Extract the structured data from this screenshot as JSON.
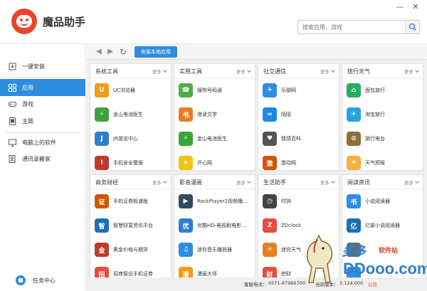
{
  "header": {
    "title": "魔品助手",
    "search_placeholder": "搜索应用，游戏",
    "window_controls": [
      "minimize-icon",
      "close-icon"
    ]
  },
  "sidebar": {
    "items": [
      {
        "label": "一键安装",
        "icon": "install-icon"
      },
      {
        "label": "应用",
        "icon": "apps-grid-icon",
        "active": true
      },
      {
        "label": "游戏",
        "icon": "game-icon"
      },
      {
        "label": "主题",
        "icon": "theme-icon"
      },
      {
        "label": "电脑上的软件",
        "icon": "computer-icon"
      },
      {
        "label": "通讯录搬家",
        "icon": "contacts-icon"
      }
    ],
    "task_center": "任务中心"
  },
  "toolbar": {
    "back": "◀",
    "forward": "▶",
    "refresh": "↻",
    "install_local": "安装本地应用"
  },
  "more_label": "更多",
  "categories": [
    {
      "title": "系统工具",
      "apps": [
        {
          "name": "UC浏览器",
          "color": "#f39c12",
          "glyph": "U"
        },
        {
          "name": "金山电池医生",
          "color": "#3da33d",
          "glyph": "⚡"
        },
        {
          "name": "JR游览中心",
          "color": "#2f7dcf",
          "glyph": "J"
        },
        {
          "name": "手机安全警报",
          "color": "#c0392b",
          "glyph": "!"
        }
      ]
    },
    {
      "title": "实用工具",
      "apps": [
        {
          "name": "搜狗号码通",
          "color": "#4cae4c",
          "glyph": "☎"
        },
        {
          "name": "塔读文学",
          "color": "#e67e22",
          "glyph": "书"
        },
        {
          "name": "金山电池医生",
          "color": "#3da33d",
          "glyph": "⚡"
        },
        {
          "name": "开心网",
          "color": "#f1c40f",
          "glyph": "★"
        }
      ]
    },
    {
      "title": "社交通信",
      "apps": [
        {
          "name": "乐聊网",
          "color": "#2f8de0",
          "glyph": "✈"
        },
        {
          "name": "陌陌",
          "color": "#1e88e5",
          "glyph": "∞"
        },
        {
          "name": "情感百科",
          "color": "#555555",
          "glyph": "♥"
        },
        {
          "name": "激动网",
          "color": "#d35400",
          "glyph": "激"
        }
      ]
    },
    {
      "title": "旅行天气",
      "apps": [
        {
          "name": "面包旅行",
          "color": "#27ae60",
          "glyph": "⌂"
        },
        {
          "name": "淘宝旅行",
          "color": "#29a3e0",
          "glyph": "✈"
        },
        {
          "name": "旅行电台",
          "color": "#8e6e3c",
          "glyph": "⊙"
        },
        {
          "name": "天气预报",
          "color": "#f5b041",
          "glyph": "☀"
        }
      ]
    },
    {
      "title": "商务财经",
      "apps": [
        {
          "name": "手机证券极速版",
          "color": "#d35400",
          "glyph": "证"
        },
        {
          "name": "智慧财富资讯平台",
          "color": "#1f6fb5",
          "glyph": "智"
        },
        {
          "name": "黄金价格与期货",
          "color": "#c0392b",
          "glyph": "金"
        },
        {
          "name": "招商智远手机证券",
          "color": "#e74c3c",
          "glyph": "招"
        }
      ]
    },
    {
      "title": "影音漫画",
      "apps": [
        {
          "name": "RockPlayer2视频播放器",
          "color": "#34495e",
          "glyph": "▶"
        },
        {
          "name": "优酷HD-电视剧电影动漫",
          "color": "#2f7dcf",
          "glyph": "优"
        },
        {
          "name": "迷你音乐播放器",
          "color": "#2f8de0",
          "glyph": "♫"
        },
        {
          "name": "漫画大师",
          "color": "#f39c12",
          "glyph": "漫"
        }
      ]
    },
    {
      "title": "生活助手",
      "apps": [
        {
          "name": "时钟",
          "color": "#444444",
          "glyph": "◷"
        },
        {
          "name": "ZDclock",
          "color": "#e74c3c",
          "glyph": "Z"
        },
        {
          "name": "迷你天气",
          "color": "#e67e22",
          "glyph": "☀"
        },
        {
          "name": "挖财",
          "color": "#e74c3c",
          "glyph": "财"
        }
      ]
    },
    {
      "title": "阅读资讯",
      "apps": [
        {
          "name": "小说阅读器",
          "color": "#2f8de0",
          "glyph": "书"
        },
        {
          "name": "亿部小说阅读器",
          "color": "#1f6fb5",
          "glyph": "亿"
        },
        {
          "name": "",
          "color": "#5d6d7e",
          "glyph": ""
        },
        {
          "name": "",
          "color": "#2f8de0",
          "glyph": ""
        }
      ]
    }
  ],
  "footer": {
    "hotline_label": "客服电话：",
    "hotline": "0571-87966700",
    "version_label": "当前版本：",
    "version": "3.124.000",
    "notice": "公告"
  },
  "watermark": {
    "brand": "多多",
    "site": "软件站",
    "url": "DDooo.com"
  }
}
